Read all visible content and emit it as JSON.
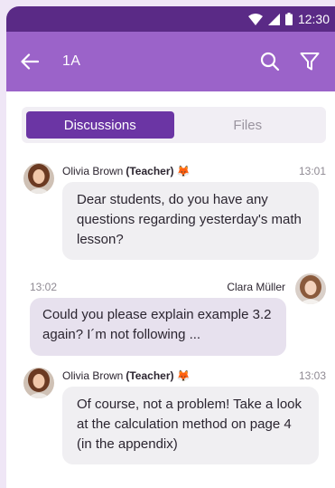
{
  "status_bar": {
    "time": "12:30"
  },
  "app_bar": {
    "title": "1A",
    "back_icon": "arrow-left-icon",
    "search_icon": "search-icon",
    "filter_icon": "filter-icon"
  },
  "tabs": [
    {
      "label": "Discussions",
      "active": true
    },
    {
      "label": "Files",
      "active": false
    }
  ],
  "messages": [
    {
      "sender": "Olivia Brown",
      "role": "(Teacher)",
      "emoji": "🦊",
      "time": "13:01",
      "text": "Dear students, do you have any questions regarding yesterday's math lesson?",
      "direction": "incoming"
    },
    {
      "sender": "Clara Müller",
      "time": "13:02",
      "text": "Could you please explain example 3.2 again? I´m not following ...",
      "direction": "outgoing"
    },
    {
      "sender": "Olivia Brown",
      "role": "(Teacher)",
      "emoji": "🦊",
      "time": "13:03",
      "text": "Of course, not a problem! Take a look at the calculation method on page 4 (in the appendix)",
      "direction": "incoming"
    }
  ],
  "colors": {
    "status_bar": "#5a2a86",
    "app_bar": "#9b63c9",
    "active_tab": "#6b35a4",
    "incoming_bubble": "#f0eff2",
    "outgoing_bubble": "#e7e1ee"
  }
}
